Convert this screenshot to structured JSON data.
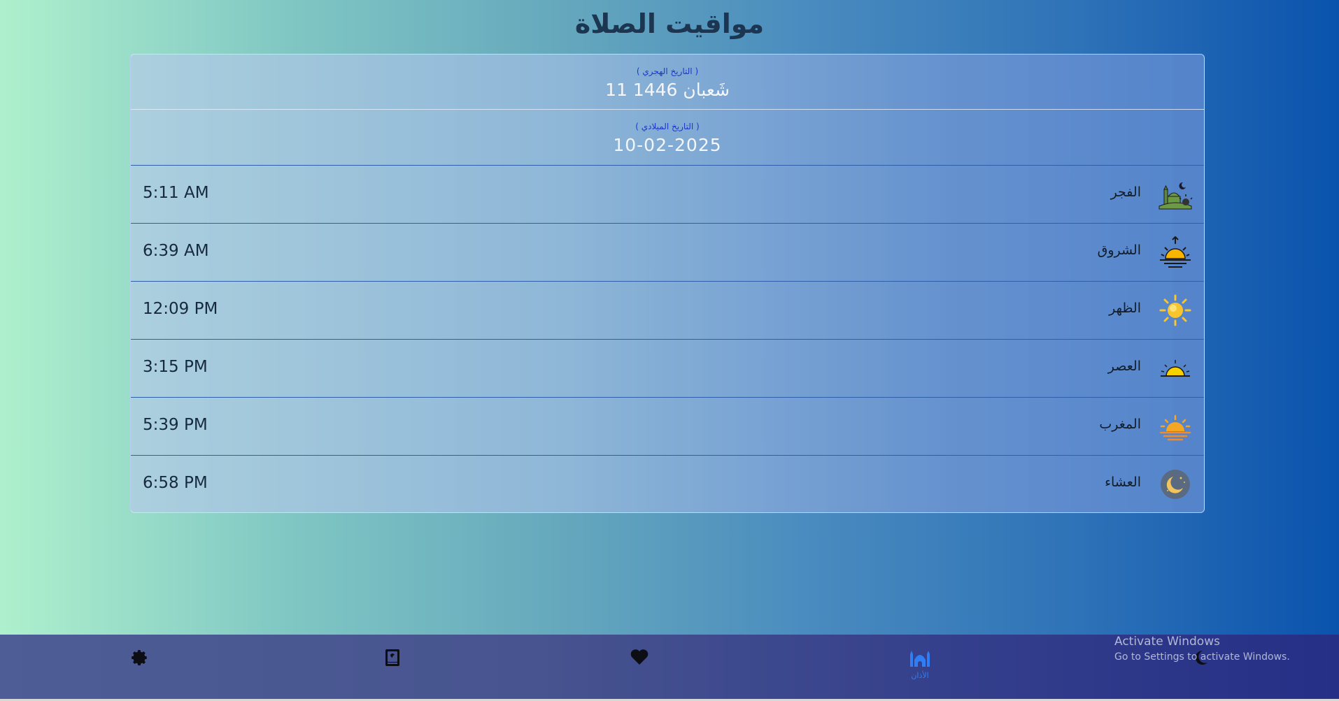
{
  "page_title": "مواقيت الصلاة",
  "dates": {
    "hijri_label": "( التاريخ الهجري )",
    "hijri_value": "11 شَعبان 1446",
    "gregorian_label": "( التاريخ الميلادي )",
    "gregorian_value": "10-02-2025"
  },
  "prayers": [
    {
      "name": "الفجر",
      "time": "5:11 AM",
      "icon": "fajr-mosque-icon"
    },
    {
      "name": "الشروق",
      "time": "6:39 AM",
      "icon": "sunrise-icon"
    },
    {
      "name": "الظهر",
      "time": "12:09 PM",
      "icon": "sun-icon"
    },
    {
      "name": "العصر",
      "time": "3:15 PM",
      "icon": "half-sun-icon"
    },
    {
      "name": "المغرب",
      "time": "5:39 PM",
      "icon": "sunset-icon"
    },
    {
      "name": "العشاء",
      "time": "6:58 PM",
      "icon": "moon-night-icon"
    }
  ],
  "nav": {
    "items": [
      "settings-icon",
      "quran-book-icon",
      "heart-icon",
      "mosque-icon",
      "crescent-icon"
    ],
    "active_label": "الأذان"
  },
  "watermark": {
    "line1": "Activate Windows",
    "line2": "Go to Settings to activate Windows."
  },
  "colors": {
    "nav_active": "#2f7ef5",
    "date_label": "#1d37c9"
  }
}
